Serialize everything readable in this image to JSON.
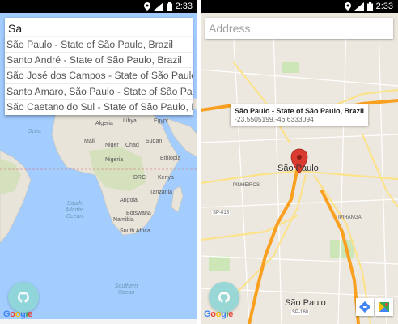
{
  "status_bar": {
    "time": "2:33",
    "network": "3G"
  },
  "left_screen": {
    "search": {
      "value": "Sa"
    },
    "suggestions": [
      "São Paulo - State of São Paulo, Brazil",
      "Santo André - State of São Paulo, Brazil",
      "São José dos Campos - State of São Paulo, Brazil",
      "Santo Amaro, São Paulo - State of São Paulo, Brazil",
      "São Caetano do Sul - State of São Paulo, Brazil"
    ],
    "map_labels": {
      "ocean": "Ocea",
      "algeria": "Algeria",
      "libya": "Libya",
      "egypt": "Egypt",
      "mali": "Mali",
      "niger": "Niger",
      "chad": "Chad",
      "sudan": "Sudan",
      "nigeria": "Nigeria",
      "ethiopia": "Ethiopia",
      "kenya": "Kenya",
      "drc": "DRC",
      "tanzania": "Tanzania",
      "angola": "Angola",
      "namibia": "Namibia",
      "botswana": "Botswana",
      "south_africa": "South Africa",
      "south_atlantic": "South Atlantic Ocean",
      "southern_ocean": "Southern Ocean"
    },
    "google": "Google"
  },
  "right_screen": {
    "search": {
      "placeholder": "Address"
    },
    "info_window": {
      "title": "São Paulo - State of São Paulo, Brazil",
      "coords": "-23.5505199,-46.6333094"
    },
    "map_labels": {
      "city": "São Paulo",
      "pinheiros": "PINHEIROS",
      "ipiranga": "IPIRANGA",
      "road_sp015": "SP-015",
      "road_sp160": "SP-160",
      "city_bottom": "São Paulo"
    },
    "google": "Google"
  },
  "colors": {
    "fab": "#8fd6d6",
    "ocean": "#a3ccff",
    "land": "#e8e4da",
    "highway": "#f9a021",
    "marker": "#d93b30"
  }
}
